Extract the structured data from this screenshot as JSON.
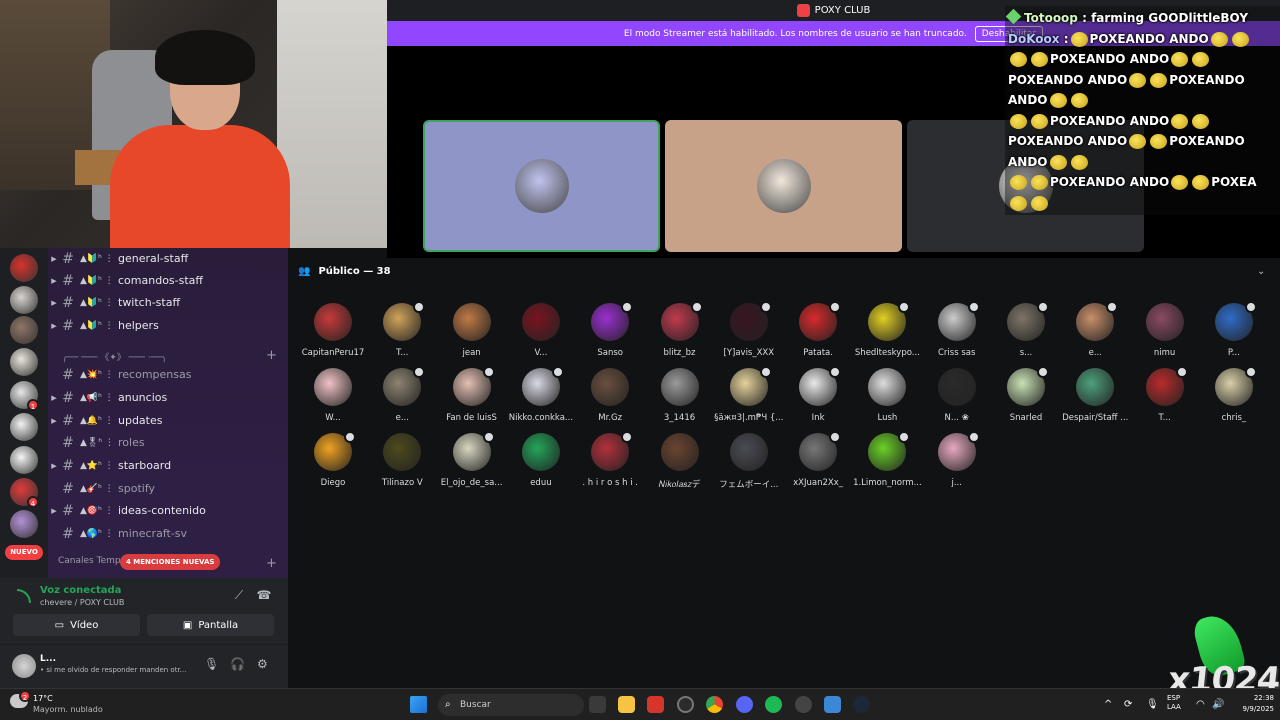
{
  "window": {
    "title": "POXY CLUB"
  },
  "streamer_banner": {
    "text": "El modo Streamer está habilitado. Los nombres de usuario se han truncado.",
    "button": "Deshabilitar"
  },
  "chat": [
    {
      "user": "Totooop",
      "message": ": farming GOODlittleBOY"
    },
    {
      "user": "DoKoox",
      "message": ":"
    },
    {
      "line": "POXEANDO ANDO"
    },
    {
      "line": "POXEANDO ANDO"
    },
    {
      "line": "POXEANDO ANDO"
    },
    {
      "line": "POXEANDO ANDO"
    },
    {
      "line": "POXEANDO ANDO"
    },
    {
      "line": "POXEANDO ANDO"
    },
    {
      "line": "POXEANDO ANDO"
    },
    {
      "line": "POXEANDO ANDO"
    },
    {
      "line": "POXEA"
    }
  ],
  "servers": [
    {
      "color": "#d8322c",
      "badge": ""
    },
    {
      "color": "#d9d4cf",
      "badge": ""
    },
    {
      "color": "#8e7566",
      "badge": ""
    },
    {
      "color": "#e9e3da",
      "badge": ""
    },
    {
      "color": "#e7e7e7",
      "badge": "1"
    },
    {
      "color": "#f2f2f2",
      "badge": ""
    },
    {
      "color": "#f5f5f5",
      "badge": ""
    },
    {
      "color": "#e13b3b",
      "badge": "4"
    },
    {
      "color": "#b392d6",
      "badge": ""
    }
  ],
  "sidebar": {
    "channels": [
      {
        "name": "general-staff",
        "muted": false,
        "expand": true
      },
      {
        "name": "comandos-staff",
        "muted": false,
        "expand": true
      },
      {
        "name": "twitch-staff",
        "muted": false,
        "expand": true
      },
      {
        "name": "helpers",
        "muted": false,
        "expand": true
      },
      {
        "name": "recompensas",
        "muted": true,
        "expand": false
      },
      {
        "name": "anuncios",
        "muted": false,
        "expand": true
      },
      {
        "name": "updates",
        "muted": false,
        "expand": true
      },
      {
        "name": "roles",
        "muted": true,
        "expand": false
      },
      {
        "name": "starboard",
        "muted": false,
        "expand": true
      },
      {
        "name": "spotify",
        "muted": true,
        "expand": false
      },
      {
        "name": "ideas-contenido",
        "muted": false,
        "expand": true
      },
      {
        "name": "minecraft-sv",
        "muted": true,
        "expand": false
      }
    ],
    "divider": "╭── ─── 《✦》 ─── ·──╮",
    "category": "Canales Tempo",
    "new_badge": "NUEVO",
    "mentions_pill": "4 MENCIONES NUEVAS"
  },
  "voice_panel": {
    "status": "Voz conectada",
    "location": "chevere / POXY CLUB",
    "video_button": "Vídeo",
    "screen_button": "Pantalla"
  },
  "user_panel": {
    "name": "L...",
    "status": "• si me olvido de responder manden otr..."
  },
  "stage_tiles": [
    {
      "bg": "#8f95c6",
      "border": "#3ba55d",
      "avatar": "#c0c4ef"
    },
    {
      "bg": "#c7a288",
      "border": "",
      "avatar": "#f2e7dc"
    },
    {
      "bg": "#2b2d31",
      "border": "",
      "avatar": "#f5f5f5"
    }
  ],
  "audience": {
    "title": "Público — 38",
    "members": [
      {
        "name": "CapitanPeru17",
        "color": "#c73a3a",
        "mic": false
      },
      {
        "name": "T...",
        "color": "#d0a35a",
        "mic": true
      },
      {
        "name": "jean",
        "color": "#c07a45",
        "mic": false
      },
      {
        "name": "V...",
        "color": "#7a1420",
        "mic": false
      },
      {
        "name": "Sanso",
        "color": "#9b2fd1",
        "mic": true
      },
      {
        "name": "blitz_bz",
        "color": "#c23a4d",
        "mic": true
      },
      {
        "name": "[Y]avis_XXX",
        "color": "#3a1422",
        "mic": true
      },
      {
        "name": "Patata.",
        "color": "#d82a2a",
        "mic": true
      },
      {
        "name": "Shedlteskypo...",
        "color": "#e3cf22",
        "mic": true
      },
      {
        "name": "Criss sas",
        "color": "#cccccc",
        "mic": true
      },
      {
        "name": "s...",
        "color": "#7d7467",
        "mic": true
      },
      {
        "name": "e...",
        "color": "#c98f6a",
        "mic": true
      },
      {
        "name": "nimu",
        "color": "#8a4a63",
        "mic": false
      },
      {
        "name": "P...",
        "color": "#2e6dc9",
        "mic": true
      },
      {
        "name": "W...",
        "color": "#f0c2c6",
        "mic": false
      },
      {
        "name": "e...",
        "color": "#8d8371",
        "mic": true
      },
      {
        "name": "Fan de luisS",
        "color": "#e4c0b3",
        "mic": true
      },
      {
        "name": "Nikko.conkka...",
        "color": "#d9d9e4",
        "mic": true
      },
      {
        "name": "Mr.Gz",
        "color": "#6a4f3f",
        "mic": false
      },
      {
        "name": "3_1416",
        "color": "#9a9a9a",
        "mic": false
      },
      {
        "name": "§äж¤3|.m₱Ч {...",
        "color": "#e6d39a",
        "mic": true
      },
      {
        "name": "Ink",
        "color": "#e9e9e9",
        "mic": true
      },
      {
        "name": "Lush",
        "color": "#dedede",
        "mic": false
      },
      {
        "name": "N... ❀",
        "color": "#2a2a2a",
        "mic": false
      },
      {
        "name": "Snarled",
        "color": "#c9e1b4",
        "mic": true
      },
      {
        "name": "Despair/Staff ...",
        "color": "#4da07a",
        "mic": false
      },
      {
        "name": "T...",
        "color": "#b92b2b",
        "mic": true
      },
      {
        "name": "chris_",
        "color": "#d8cfa8",
        "mic": true
      },
      {
        "name": "Diego",
        "color": "#f0a221",
        "mic": true
      },
      {
        "name": "Tilinazo V",
        "color": "#4c4a1c",
        "mic": false
      },
      {
        "name": "El_ojo_de_sa...",
        "color": "#d9d7c1",
        "mic": true
      },
      {
        "name": "eduu",
        "color": "#23a55a",
        "mic": false
      },
      {
        "name": ". h i r o s h i .",
        "color": "#b3303c",
        "mic": true
      },
      {
        "name": "𝑁𝑖𝑘𝑜𝑙𝑎𝑠𝑧デ",
        "color": "#6c4431",
        "mic": false
      },
      {
        "name": "フェムボーイ...",
        "color": "#4b4b55",
        "mic": false
      },
      {
        "name": "xXJuan2Xx_",
        "color": "#777777",
        "mic": true
      },
      {
        "name": "1.Limon_norm...",
        "color": "#6ad127",
        "mic": true
      },
      {
        "name": "j...",
        "color": "#e8a9c0",
        "mic": true
      }
    ]
  },
  "taskbar": {
    "weather_temp": "17°C",
    "weather_desc": "Mayorm. nublado",
    "weather_badge": "2",
    "search_placeholder": "Buscar",
    "lang_line1": "ESP",
    "lang_line2": "LAA",
    "time": "22:38",
    "date": "9/9/2025"
  },
  "watermark": "x1024"
}
